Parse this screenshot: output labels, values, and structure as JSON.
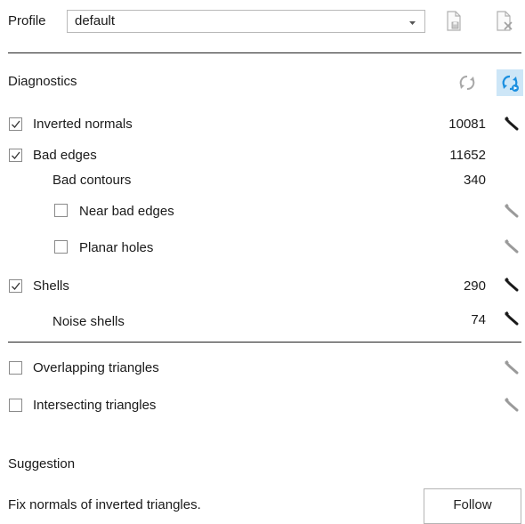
{
  "profile": {
    "label": "Profile",
    "selected": "default",
    "icons": [
      "save-profile-icon",
      "delete-profile-icon"
    ]
  },
  "diagnostics": {
    "title": "Diagnostics",
    "icons": [
      "refresh-icon",
      "auto-refresh-icon"
    ],
    "items": [
      {
        "label": "Inverted normals",
        "checked": true,
        "count": "10081",
        "fix_icon": "wrench-icon-dark"
      },
      {
        "label": "Bad edges",
        "checked": true,
        "count": "11652"
      },
      {
        "label": "Bad contours",
        "count": "340"
      },
      {
        "label": "Near bad edges",
        "checked": false,
        "fix_icon": "wrench-icon-light"
      },
      {
        "label": "Planar holes",
        "checked": false,
        "fix_icon": "wrench-icon-light"
      },
      {
        "label": "Shells",
        "checked": true,
        "count": "290",
        "fix_icon": "wrench-icon-dark"
      },
      {
        "label": "Noise shells",
        "count": "74",
        "fix_icon": "wrench-icon-dark"
      }
    ],
    "advanced": [
      {
        "label": "Overlapping triangles",
        "checked": false,
        "fix_icon": "wrench-icon-light"
      },
      {
        "label": "Intersecting triangles",
        "checked": false,
        "fix_icon": "wrench-icon-light"
      }
    ]
  },
  "suggestion": {
    "title": "Suggestion",
    "text": "Fix normals of inverted triangles.",
    "button": "Follow"
  },
  "colors": {
    "accent": "#1a8fe0",
    "accent_bg": "#cde6f7",
    "wrench_dark": "#1a1a1a",
    "wrench_light": "#9a9a9a"
  }
}
